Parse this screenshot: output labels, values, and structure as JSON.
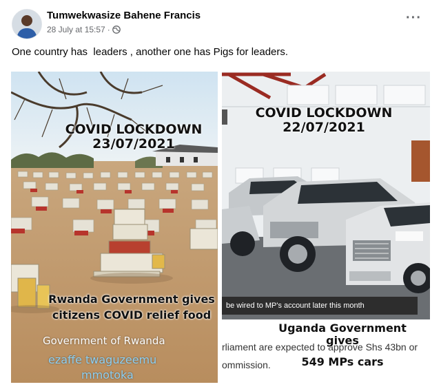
{
  "post": {
    "author": "Tumwekwasize Bahene Francis",
    "timestamp": "28 July at 15:57",
    "separator": "·",
    "caption": "One country has  leaders , another one has Pigs for leaders.",
    "more_icon": "more-options-icon",
    "privacy_icon": "globe-icon"
  },
  "image": {
    "left": {
      "heading_line1": "COVID LOCKDOWN",
      "heading_line2": "23/07/2021",
      "body_line1": "Rwanda Government gives",
      "body_line2": "citizens COVID relief food",
      "watermark_line1": "Government of Rwanda",
      "watermark_line2": "ezaffe twaguzeemu",
      "watermark_line3": "mmotoka"
    },
    "right": {
      "heading_line1": "COVID LOCKDOWN",
      "heading_line2": "22/07/2021",
      "ticker": "be wired to MP's account later this month",
      "news_line1": "rliament are expected to approve Shs 43bn or",
      "news_line2": "ommission.",
      "body_line1": "Uganda Government gives",
      "body_line2": "549 MPs cars"
    }
  }
}
